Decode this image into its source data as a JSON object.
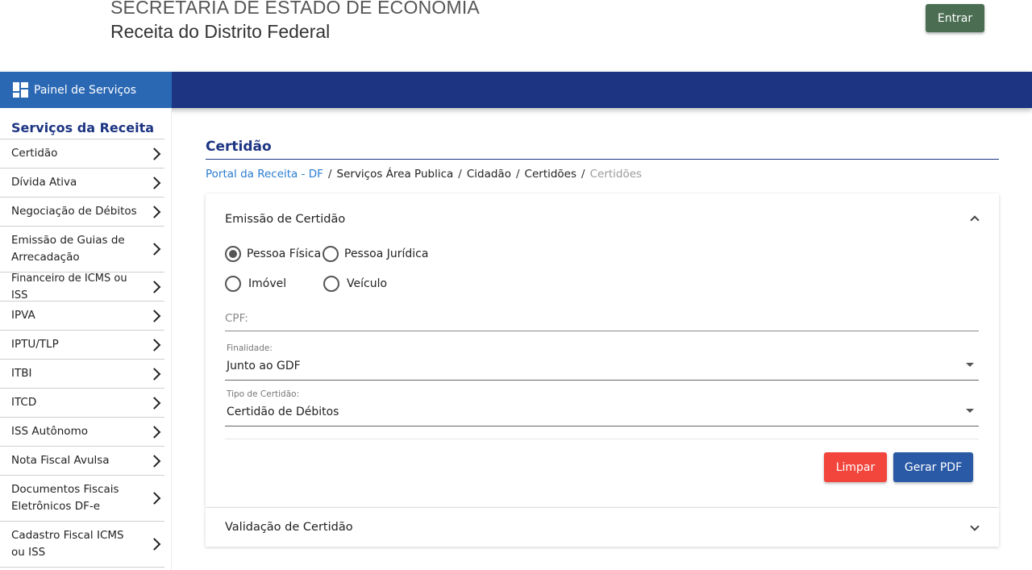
{
  "header": {
    "org_line1": "SECRETARIA DE ESTADO DE ECONOMIA",
    "org_line2": "Receita do Distrito Federal",
    "login_label": "Entrar"
  },
  "nav": {
    "panel_label": "Painel de Serviços",
    "panel_icon": "grid-icon"
  },
  "sidebar": {
    "title": "Serviços da Receita",
    "items": [
      {
        "label": "Certidão"
      },
      {
        "label": "Dívida Ativa"
      },
      {
        "label": "Negociação de Débitos"
      },
      {
        "label": "Emissão de Guias de Arrecadação"
      },
      {
        "label": "Financeiro de ICMS ou ISS"
      },
      {
        "label": "IPVA"
      },
      {
        "label": "IPTU/TLP"
      },
      {
        "label": "ITBI"
      },
      {
        "label": "ITCD"
      },
      {
        "label": "ISS Autônomo"
      },
      {
        "label": "Nota Fiscal Avulsa"
      },
      {
        "label": "Documentos Fiscais Eletrônicos DF-e"
      },
      {
        "label": "Cadastro Fiscal ICMS ou ISS"
      }
    ]
  },
  "main": {
    "title": "Certidão",
    "breadcrumb": {
      "portal": "Portal da Receita - DF",
      "area": "Serviços Área Publica",
      "cidadao": "Cidadão",
      "certidoes": "Certidões",
      "current": "Certidões",
      "separator": "/"
    },
    "emissao": {
      "title": "Emissão de Certidão",
      "radios": {
        "pessoa_fisica": "Pessoa Física",
        "pessoa_juridica": "Pessoa Jurídica",
        "imovel": "Imóvel",
        "veiculo": "Veículo"
      },
      "selected_radio": "Pessoa Física",
      "cpf_placeholder": "CPF:",
      "finalidade": {
        "caption": "Finalidade:",
        "value": "Junto ao GDF"
      },
      "tipo": {
        "caption": "Tipo de Certidão:",
        "value": "Certidão de Débitos"
      },
      "clear_label": "Limpar",
      "pdf_label": "Gerar PDF"
    },
    "validacao": {
      "title": "Validação de Certidão"
    }
  },
  "colors": {
    "nav_blue": "#1c3482",
    "panel_blue": "#2a68b4",
    "login_green": "#4b6e52",
    "clear_red": "#f2453c",
    "pdf_blue": "#2a5aa6",
    "link_blue": "#2a7ccf"
  }
}
